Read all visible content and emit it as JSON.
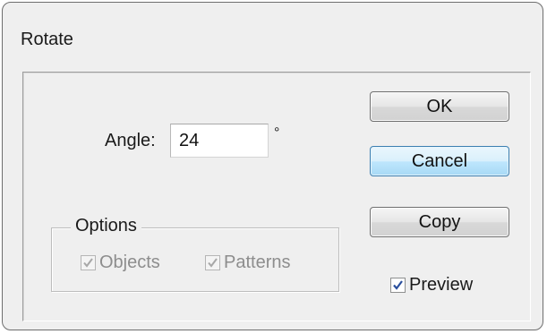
{
  "dialog": {
    "title": "Rotate"
  },
  "angle": {
    "label": "Angle:",
    "value": "24",
    "unit": "°"
  },
  "buttons": {
    "ok": "OK",
    "cancel": "Cancel",
    "copy": "Copy"
  },
  "options": {
    "legend": "Options",
    "objects": {
      "label": "Objects",
      "checked": true,
      "enabled": false
    },
    "patterns": {
      "label": "Patterns",
      "checked": true,
      "enabled": false
    }
  },
  "preview": {
    "label": "Preview",
    "checked": true,
    "enabled": true
  },
  "colors": {
    "dialog_bg": "#efefef",
    "default_button": "#bee6fd",
    "check_enabled": "#2a4f9d",
    "check_disabled": "#a8a8a8"
  }
}
